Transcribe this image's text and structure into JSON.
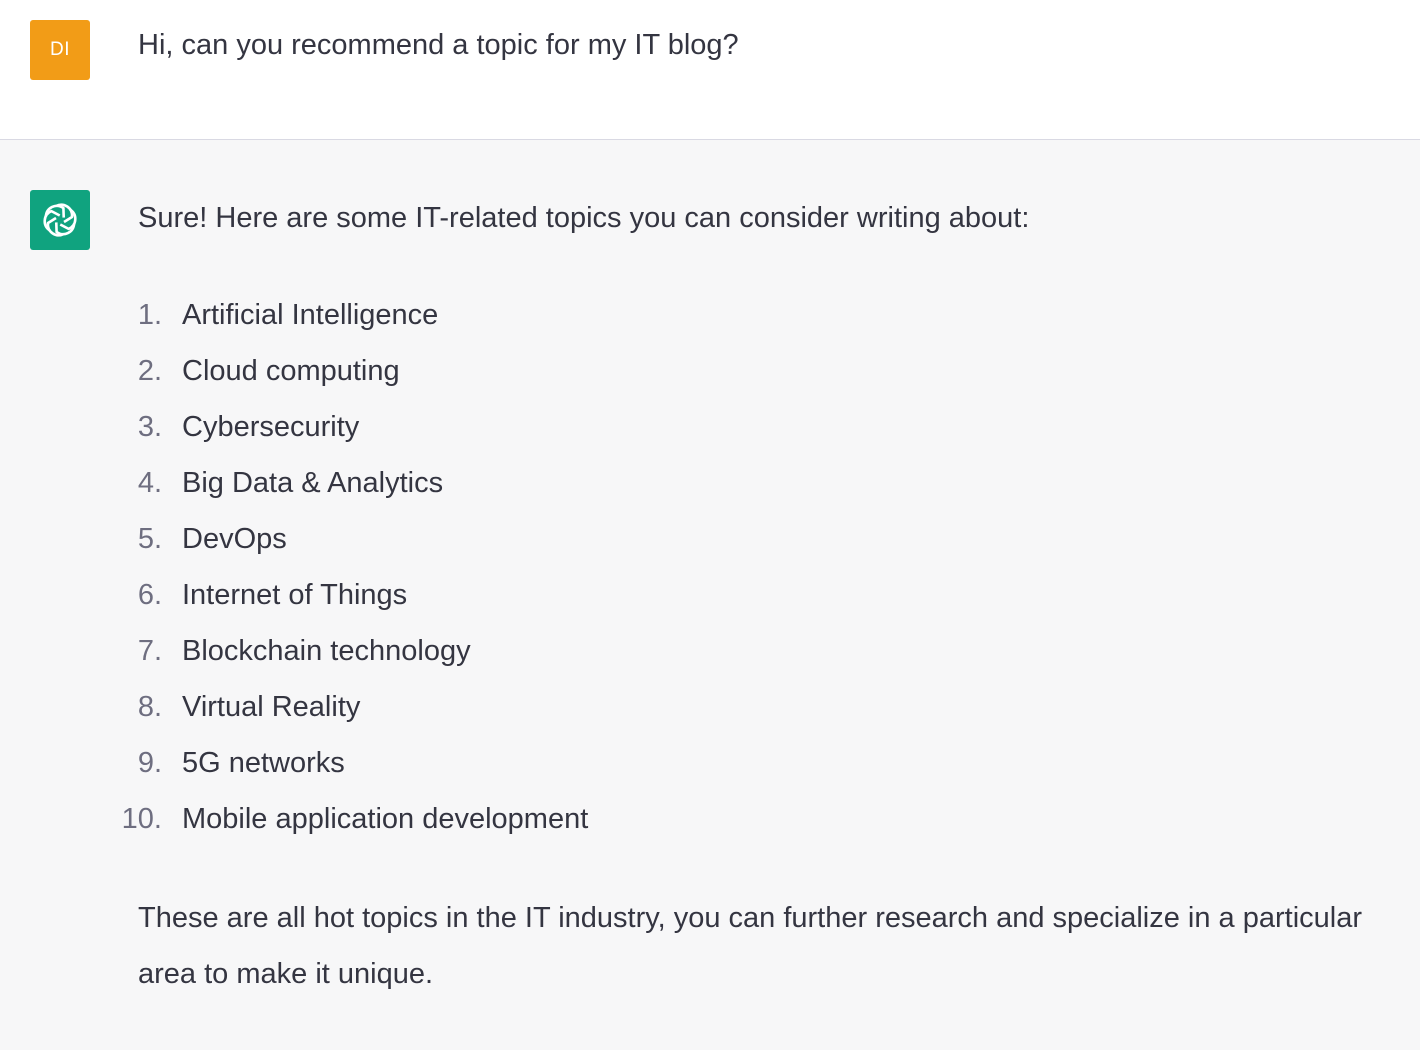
{
  "user": {
    "avatar_initials": "DI",
    "avatar_color": "#f29c17",
    "message": "Hi, can you recommend a topic for my IT blog?"
  },
  "assistant": {
    "avatar_icon": "openai-logo-icon",
    "avatar_color": "#10a37f",
    "intro": "Sure! Here are some IT-related topics you can consider writing about:",
    "topics": [
      {
        "num": "1.",
        "label": "Artificial Intelligence"
      },
      {
        "num": "2.",
        "label": "Cloud computing"
      },
      {
        "num": "3.",
        "label": "Cybersecurity"
      },
      {
        "num": "4.",
        "label": "Big Data & Analytics"
      },
      {
        "num": "5.",
        "label": "DevOps"
      },
      {
        "num": "6.",
        "label": "Internet of Things"
      },
      {
        "num": "7.",
        "label": "Blockchain technology"
      },
      {
        "num": "8.",
        "label": "Virtual Reality"
      },
      {
        "num": "9.",
        "label": "5G networks"
      },
      {
        "num": "10.",
        "label": "Mobile application development"
      }
    ],
    "closing": "These are all hot topics in the IT industry, you can further research and specialize in a particular area to make it unique."
  }
}
